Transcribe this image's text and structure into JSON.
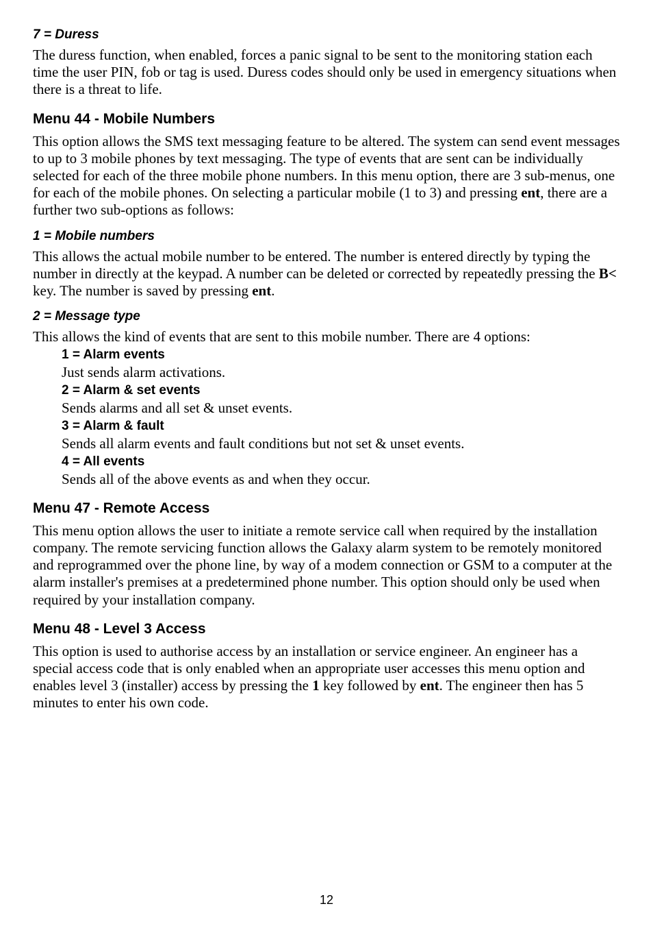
{
  "s1": {
    "h": "7 = Duress",
    "p1a": "The duress function, when enabled, forces a panic signal to be sent to the monitoring station each time the user PIN, fob or tag is used. Duress codes should only be used in emergency situations when there is a threat to life."
  },
  "s2": {
    "h": "Menu 44 - Mobile Numbers",
    "p1a": "This option allows the SMS text messaging feature to be altered. The system can send event messages to up to 3 mobile phones by text messaging. The type of events that are sent can be individually selected for each of the three mobile phone numbers. In this menu option, there are 3 sub-menus, one for each of the mobile phones. On selecting a particular mobile (1 to 3) and pressing ",
    "p1b": "ent",
    "p1c": ", there are a further two sub-options as follows:"
  },
  "s3": {
    "h": "1 = Mobile numbers",
    "p1a": "This allows the actual mobile number to be entered. The number is entered directly by typing the number in directly at the keypad. A number can be deleted or corrected by repeatedly pressing the ",
    "p1b": "B<",
    "p1c": " key. The number is saved by pressing ",
    "p1d": "ent",
    "p1e": "."
  },
  "s4": {
    "h": "2 = Message type",
    "intro": "This allows the kind of events that are sent to this mobile number. There are 4 options:",
    "o1l": "1 = Alarm events",
    "o1d": "Just sends alarm activations.",
    "o2l": "2 = Alarm & set events",
    "o2d": "Sends alarms and all set & unset events.",
    "o3l": "3 = Alarm & fault",
    "o3d": "Sends all alarm events and fault conditions but not set & unset events.",
    "o4l": "4 = All events",
    "o4d": "Sends all of the above events as and when they occur."
  },
  "s5": {
    "h": "Menu 47 - Remote Access",
    "p1": "This menu option allows the user to initiate a remote service call when required by the installation company. The remote servicing function allows the Galaxy alarm system to be remotely monitored and reprogrammed over the phone line, by way of a modem connection or GSM to a computer at the alarm installer's premises at a predetermined phone number. This option should only be used when required by your installation company."
  },
  "s6": {
    "h": "Menu 48 - Level 3 Access",
    "p1a": "This option is used to authorise access by an installation or service engineer. An engineer has a special access code that is only enabled when an appropriate user accesses this menu option and enables level 3 (installer) access by pressing the ",
    "p1b": "1",
    "p1c": " key followed by ",
    "p1d": "ent",
    "p1e": ". The engineer then has 5 minutes to enter his own code."
  },
  "pageNum": "12"
}
